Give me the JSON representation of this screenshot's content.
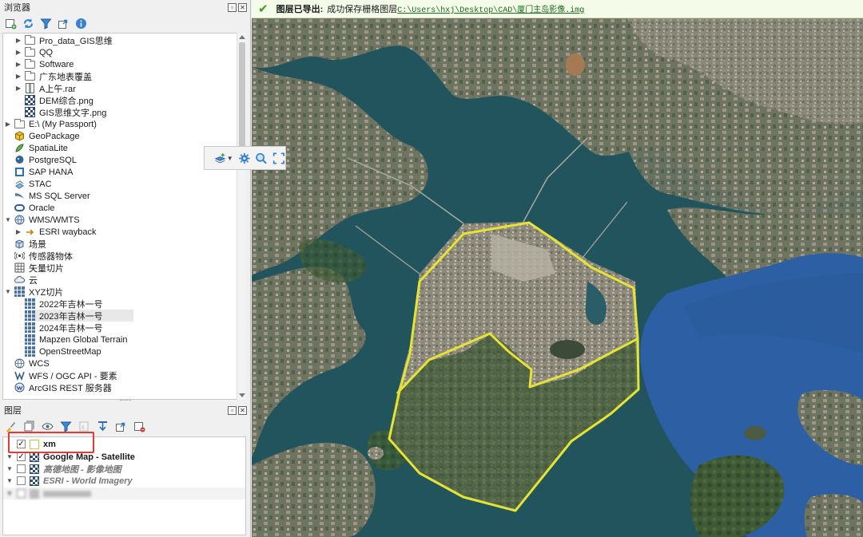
{
  "browser_panel": {
    "title": "浏览器",
    "items": [
      {
        "label": "Pro_data_GIS思维",
        "icon": "folder-icon"
      },
      {
        "label": "QQ",
        "icon": "folder-icon"
      },
      {
        "label": "Software",
        "icon": "folder-icon"
      },
      {
        "label": "广东地表覆盖",
        "icon": "folder-icon"
      },
      {
        "label": "A上午.rar",
        "icon": "archive-icon"
      },
      {
        "label": "DEM综合.png",
        "icon": "raster-icon"
      },
      {
        "label": "GIS思维文字.png",
        "icon": "raster-icon"
      },
      {
        "label": "E:\\ (My Passport)",
        "icon": "drive-folder-icon"
      },
      {
        "label": "GeoPackage",
        "icon": "geopackage-icon"
      },
      {
        "label": "SpatiaLite",
        "icon": "spatialite-icon"
      },
      {
        "label": "PostgreSQL",
        "icon": "postgresql-icon"
      },
      {
        "label": "SAP HANA",
        "icon": "sap-hana-icon"
      },
      {
        "label": "STAC",
        "icon": "stac-icon"
      },
      {
        "label": "MS SQL Server",
        "icon": "mssql-icon"
      },
      {
        "label": "Oracle",
        "icon": "oracle-icon"
      },
      {
        "label": "WMS/WMTS",
        "icon": "globe-icon"
      },
      {
        "label": "ESRI wayback",
        "icon": "wayback-icon"
      },
      {
        "label": "场景",
        "icon": "scene-icon"
      },
      {
        "label": "传感器物体",
        "icon": "sensor-icon"
      },
      {
        "label": "矢量切片",
        "icon": "vector-tile-icon"
      },
      {
        "label": "云",
        "icon": "cloud-icon"
      },
      {
        "label": "XYZ切片",
        "icon": "grid-icon"
      },
      {
        "label": "2022年吉林一号",
        "icon": "grid-icon"
      },
      {
        "label": "2023年吉林一号",
        "icon": "grid-icon"
      },
      {
        "label": "2024年吉林一号",
        "icon": "grid-icon"
      },
      {
        "label": "Mapzen Global Terrain",
        "icon": "grid-icon"
      },
      {
        "label": "OpenStreetMap",
        "icon": "grid-icon"
      },
      {
        "label": "WCS",
        "icon": "wcs-icon"
      },
      {
        "label": "WFS / OGC API - 要素",
        "icon": "wfs-icon"
      },
      {
        "label": "ArcGIS REST 服务器",
        "icon": "arcgis-icon"
      }
    ]
  },
  "layers_panel": {
    "title": "图层",
    "layers": [
      {
        "name": "xm",
        "checked": true
      },
      {
        "name": "Google Map - Satellite",
        "checked": true
      },
      {
        "name": "高德地图 - 影像地图",
        "checked": false
      },
      {
        "name": "ESRI - World Imagery",
        "checked": false
      }
    ]
  },
  "message_bar": {
    "title": "图层已导出:",
    "text": "成功保存栅格图层",
    "link": "C:\\Users\\hxj\\Desktop\\CAD\\厦门主岛影像.img"
  },
  "colors": {
    "boundary": "#e6e332",
    "water_inner": "#20525c",
    "water_sea": "#2d5fa5",
    "message_bg": "#f5fbe9",
    "highlight_red": "#e53935"
  }
}
